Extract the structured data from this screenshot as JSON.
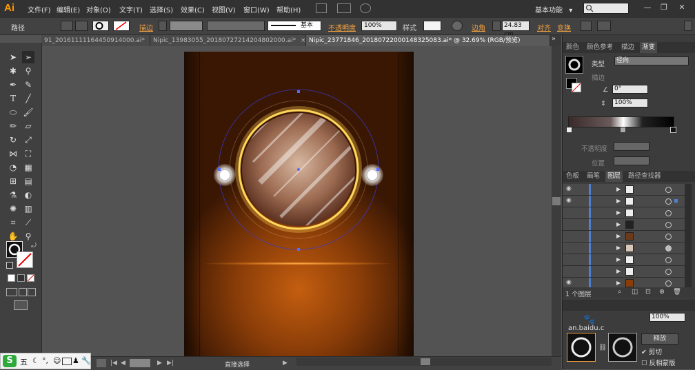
{
  "app": {
    "logo": "Ai"
  },
  "menu": [
    "文件(F)",
    "编辑(E)",
    "对象(O)",
    "文字(T)",
    "选择(S)",
    "效果(C)",
    "视图(V)",
    "窗口(W)",
    "帮助(H)"
  ],
  "workspace": {
    "label": "基本功能",
    "chevron": "▾"
  },
  "window_buttons": [
    "—",
    "❐",
    "✕"
  ],
  "control_bar": {
    "selection_type": "路径",
    "stroke_label": "描边",
    "stroke_profile": "基本",
    "opacity_label": "不透明度",
    "opacity_value": "100%",
    "style_label": "样式",
    "corner_label": "边角",
    "corner_value": "24.83",
    "corner_unit": "cm",
    "align_label": "对齐",
    "transform_label": "变换"
  },
  "tabs": [
    {
      "label": "91_20161111164450914000.ai*",
      "active": false
    },
    {
      "label": "Nipic_13983055_20180727214204802000.ai*",
      "active": false
    },
    {
      "label": "Nipic_23771846_20180722000148325083.ai* @ 32.69% (RGB/预览)",
      "active": true
    }
  ],
  "tab_close": "×",
  "tab_overflow": "»",
  "status_bar": {
    "tool_name": "直接选择"
  },
  "ime_bar": {
    "icons": [
      "sogou-logo",
      "wu",
      "moon",
      "comma",
      "emoji",
      "keyboard",
      "user",
      "wrench"
    ],
    "wu_label": "五"
  },
  "gradient_panel": {
    "tabs": [
      "颜色",
      "颜色参考",
      "描边",
      "渐变"
    ],
    "active_tab": "渐变",
    "type_label": "类型",
    "type_value": "径向",
    "stroke_label": "描边",
    "angle_value": "0°",
    "aspect_value": "100%",
    "opacity_label": "不透明度",
    "location_label": "位置"
  },
  "layers_panel": {
    "tabs": [
      "色板",
      "画笔",
      "图层",
      "路径查找器"
    ],
    "active_tab": "图层",
    "layer_count": "1 个图层",
    "rows": [
      {
        "visible": true,
        "selected": false
      },
      {
        "visible": true,
        "selected": true
      },
      {
        "visible": false,
        "selected": false
      },
      {
        "visible": false,
        "selected": false
      },
      {
        "visible": false,
        "selected": false
      },
      {
        "visible": false,
        "selected": false
      },
      {
        "visible": false,
        "selected": false
      },
      {
        "visible": false,
        "selected": false
      },
      {
        "visible": true,
        "selected": false
      }
    ]
  },
  "transparency_panel": {
    "opacity_value": "100%",
    "release_button": "释放",
    "clip_label": "剪切",
    "invert_mask_label": "反相蒙版",
    "watermark": "an.baidu.c"
  },
  "colors": {
    "accent": "#4f7fd0",
    "orange_label": "#f0a040",
    "artboard_center": "#c45e10",
    "ring_gold": "#ffd75a"
  }
}
